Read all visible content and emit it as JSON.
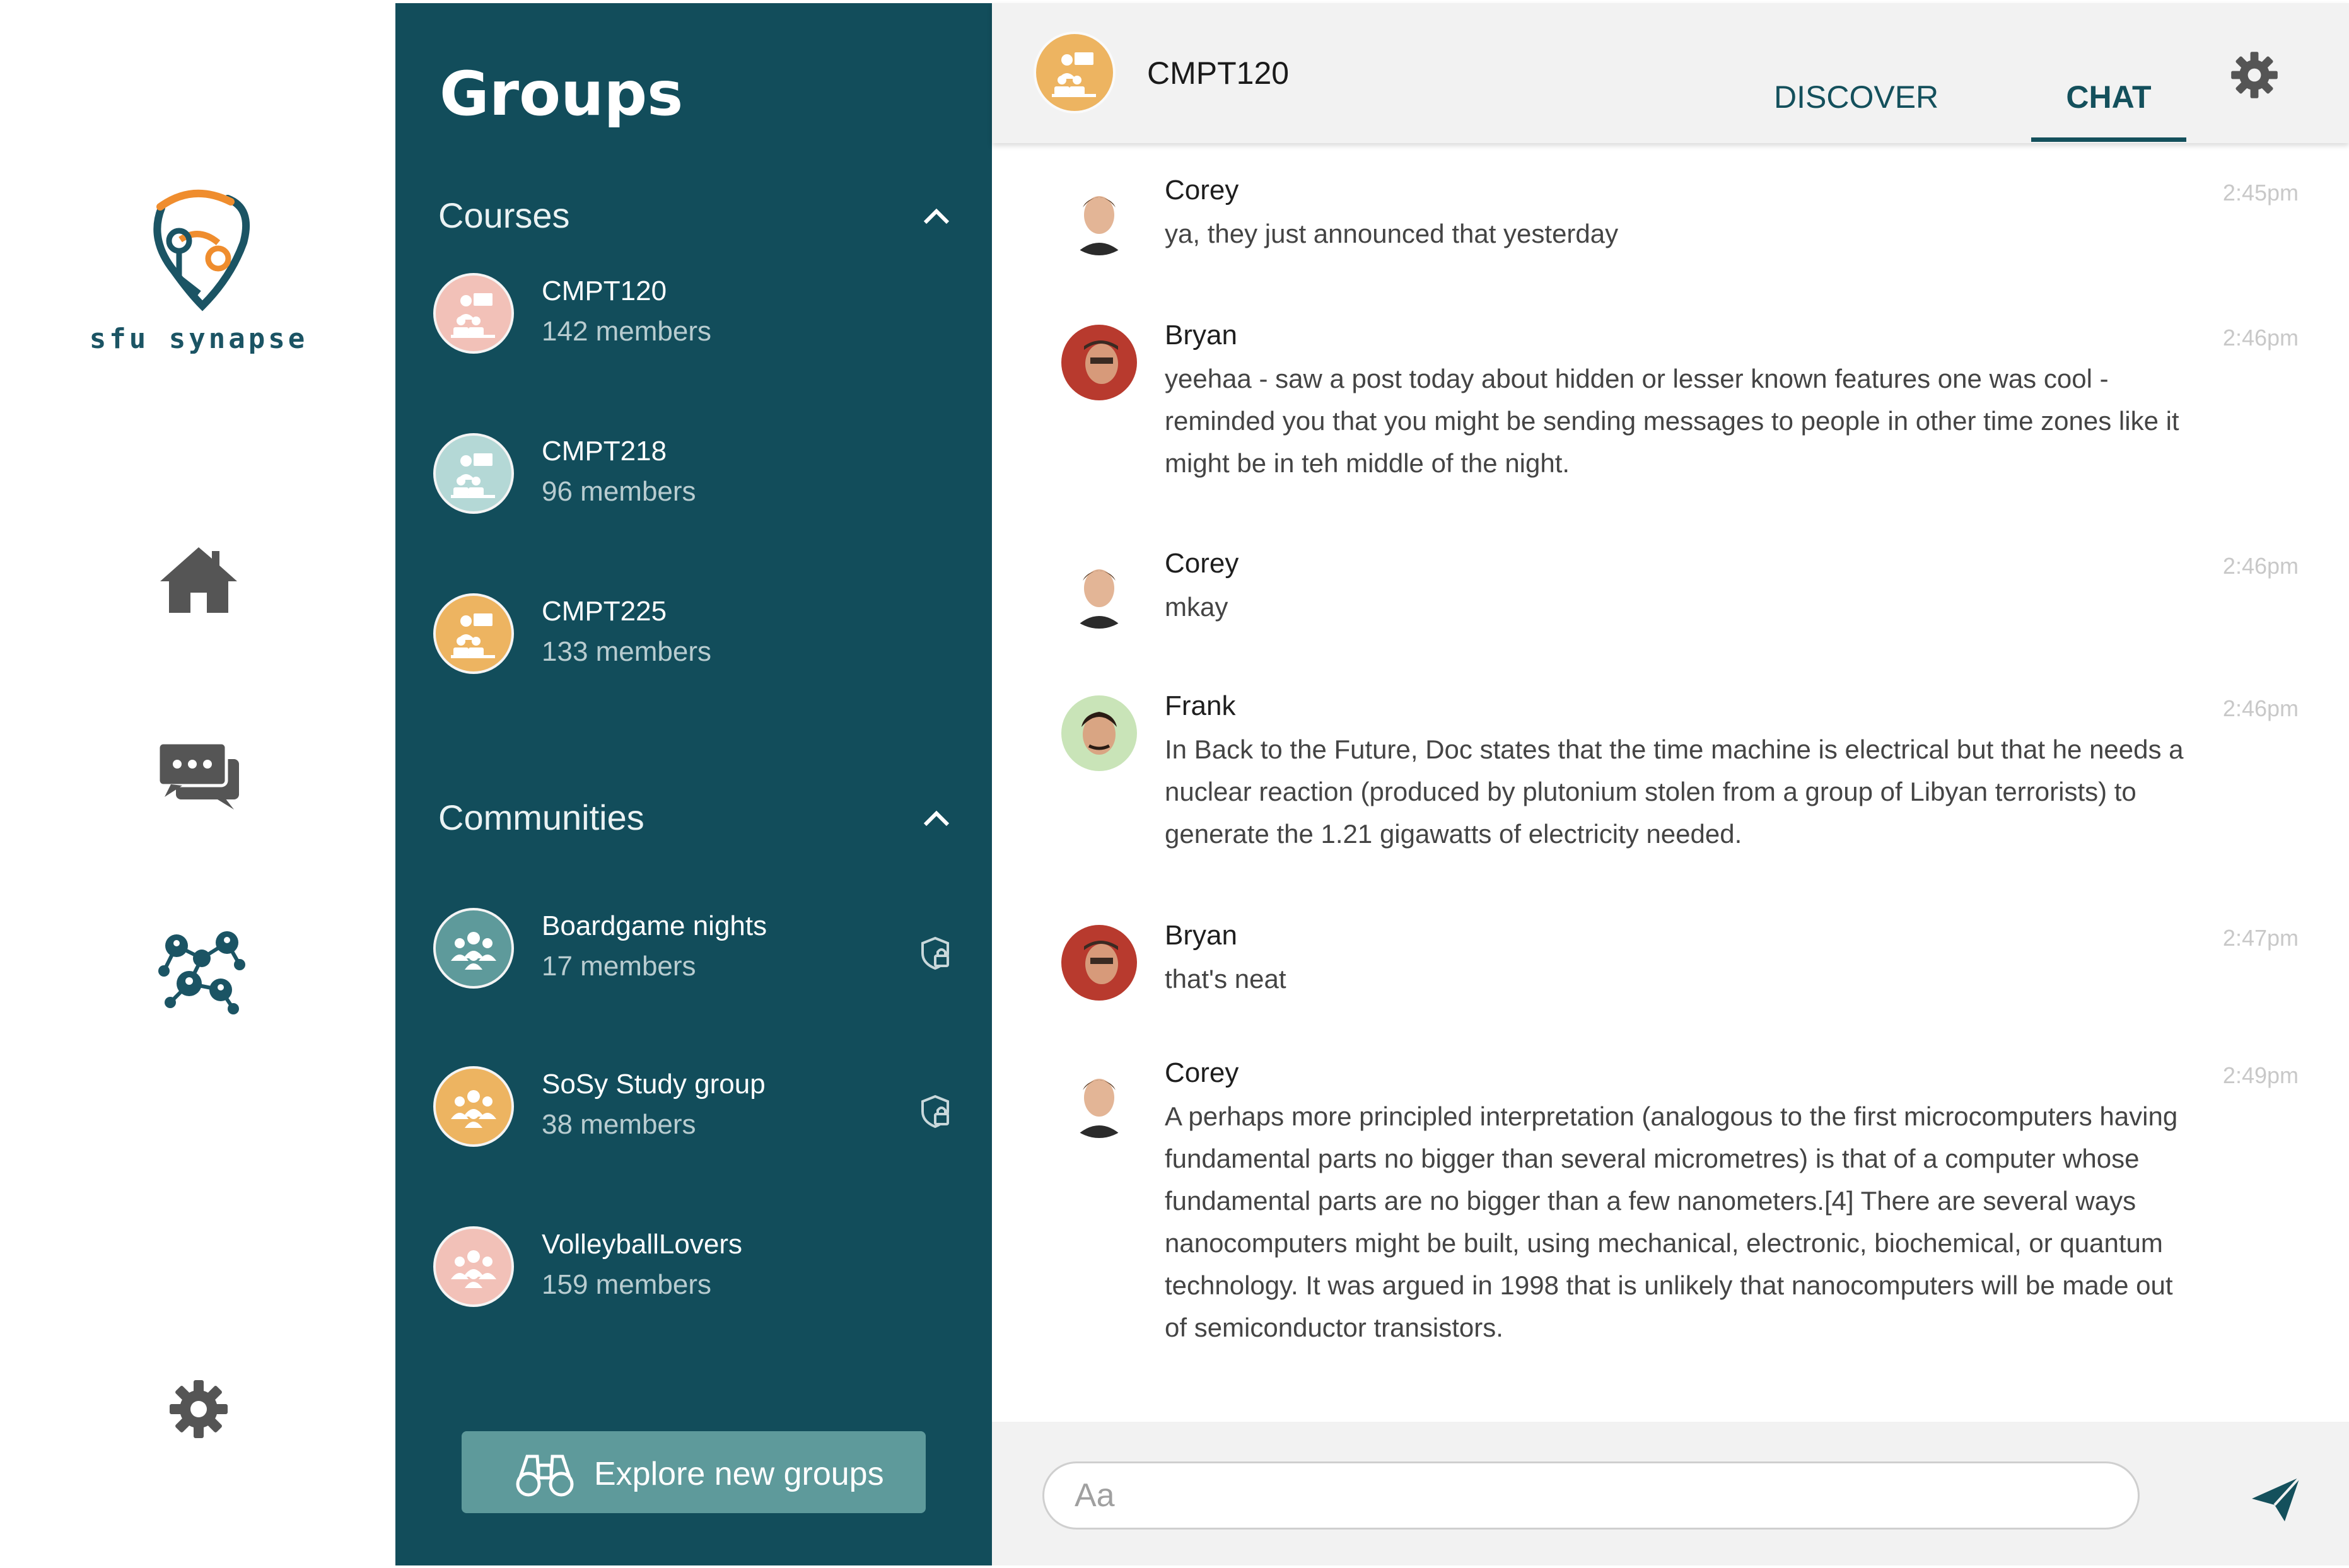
{
  "app": {
    "logo_text": "sfu synapse"
  },
  "colors": {
    "panel": "#124d5b",
    "accent_orange": "#edb461",
    "accent_pink": "#f2c1b8",
    "accent_teal": "#b4d8d6",
    "accent_sage": "#5e9a9b"
  },
  "nav": {
    "items": [
      {
        "icon": "home-icon"
      },
      {
        "icon": "chat-bubbles-icon"
      },
      {
        "icon": "network-icon"
      },
      {
        "icon": "gear-icon"
      }
    ]
  },
  "groups": {
    "title": "Groups",
    "courses": {
      "label": "Courses",
      "items": [
        {
          "name": "CMPT120",
          "members": "142 members",
          "color": "#f2c1b8"
        },
        {
          "name": "CMPT218",
          "members": "96 members",
          "color": "#b4d8d6"
        },
        {
          "name": "CMPT225",
          "members": "133 members",
          "color": "#edb461"
        }
      ]
    },
    "communities": {
      "label": "Communities",
      "items": [
        {
          "name": "Boardgame nights",
          "members": "17 members",
          "color": "#5e9a9b",
          "locked": true
        },
        {
          "name": "SoSy Study group",
          "members": "38 members",
          "color": "#edb461",
          "locked": true
        },
        {
          "name": "VolleyballLovers",
          "members": "159 members",
          "color": "#f2c1b8",
          "locked": false
        }
      ]
    },
    "explore_label": "Explore new groups"
  },
  "chat": {
    "title": "CMPT120",
    "tabs": {
      "discover": "DISCOVER",
      "chat": "CHAT"
    },
    "active_tab": "CHAT",
    "messages": [
      {
        "sender": "Corey",
        "time": "2:45pm",
        "text": "ya, they just announced that yesterday"
      },
      {
        "sender": "Bryan",
        "time": "2:46pm",
        "text": "yeehaa - saw a post today about hidden or lesser known features one was cool - reminded you that you might be sending messages to people in other time zones like it might be in teh middle of the night."
      },
      {
        "sender": "Corey",
        "time": "2:46pm",
        "text": "mkay"
      },
      {
        "sender": "Frank",
        "time": "2:46pm",
        "text": "In Back to the Future, Doc states that the time machine is electrical but that he needs a nuclear reaction (produced by plutonium stolen from a group of Libyan terrorists) to generate the 1.21 gigawatts of electricity needed."
      },
      {
        "sender": "Bryan",
        "time": "2:47pm",
        "text": "that's neat"
      },
      {
        "sender": "Corey",
        "time": "2:49pm",
        "text": "A perhaps more principled interpretation (analogous to the first microcomputers having fundamental parts no bigger than several micrometres) is that of a computer whose fundamental parts are no bigger than a few nanometers.[4] There are several ways nanocomputers might be built, using mechanical, electronic, biochemical, or quantum technology. It was argued in 1998 that is unlikely that nanocomputers will be made out of semiconductor transistors."
      }
    ],
    "composer": {
      "placeholder": "Aa"
    }
  }
}
